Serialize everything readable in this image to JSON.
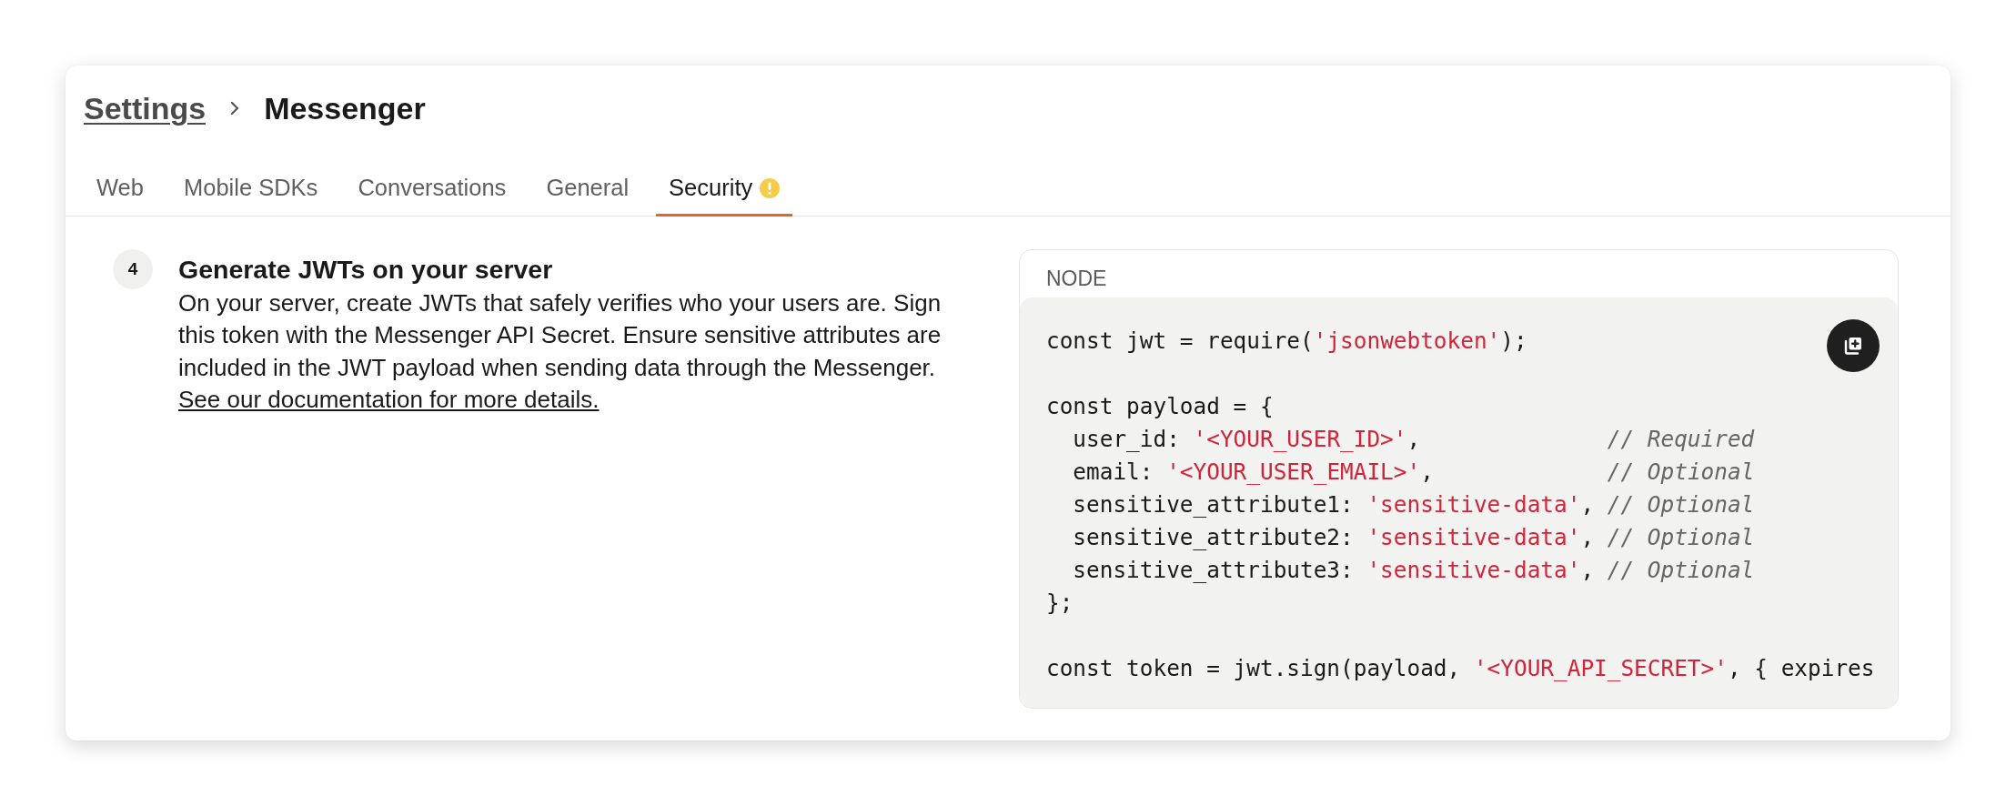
{
  "breadcrumb": {
    "parent": "Settings",
    "current": "Messenger"
  },
  "tabs": [
    {
      "label": "Web",
      "selected": false,
      "warning": false
    },
    {
      "label": "Mobile SDKs",
      "selected": false,
      "warning": false
    },
    {
      "label": "Conversations",
      "selected": false,
      "warning": false
    },
    {
      "label": "General",
      "selected": false,
      "warning": false
    },
    {
      "label": "Security",
      "selected": true,
      "warning": true
    }
  ],
  "step": {
    "number": "4",
    "title": "Generate JWTs on your server",
    "description": "On your server, create JWTs that safely verifies who your users are. Sign this token with the Messenger API Secret. Ensure sensitive attributes are included in the JWT payload when sending data through the Messenger.",
    "link": "See our documentation for more details."
  },
  "code_block": {
    "language": "NODE",
    "lines": [
      {
        "kind": "code",
        "tokens": [
          {
            "kind": "plain",
            "text": "const jwt = require("
          },
          {
            "kind": "string",
            "text": "'jsonwebtoken'"
          },
          {
            "kind": "plain",
            "text": ");"
          }
        ]
      },
      {
        "kind": "blank"
      },
      {
        "kind": "code",
        "tokens": [
          {
            "kind": "plain",
            "text": "const payload = {"
          }
        ]
      },
      {
        "kind": "code",
        "tokens": [
          {
            "kind": "plain",
            "text": "  user_id: "
          },
          {
            "kind": "string",
            "text": "'<YOUR_USER_ID>'"
          },
          {
            "kind": "plain",
            "text": ",              "
          },
          {
            "kind": "comment",
            "text": "// Required"
          }
        ]
      },
      {
        "kind": "code",
        "tokens": [
          {
            "kind": "plain",
            "text": "  email: "
          },
          {
            "kind": "string",
            "text": "'<YOUR_USER_EMAIL>'"
          },
          {
            "kind": "plain",
            "text": ",             "
          },
          {
            "kind": "comment",
            "text": "// Optional"
          }
        ]
      },
      {
        "kind": "code",
        "tokens": [
          {
            "kind": "plain",
            "text": "  sensitive_attribute1: "
          },
          {
            "kind": "string",
            "text": "'sensitive-data'"
          },
          {
            "kind": "plain",
            "text": ", "
          },
          {
            "kind": "comment",
            "text": "// Optional"
          }
        ]
      },
      {
        "kind": "code",
        "tokens": [
          {
            "kind": "plain",
            "text": "  sensitive_attribute2: "
          },
          {
            "kind": "string",
            "text": "'sensitive-data'"
          },
          {
            "kind": "plain",
            "text": ", "
          },
          {
            "kind": "comment",
            "text": "// Optional"
          }
        ]
      },
      {
        "kind": "code",
        "tokens": [
          {
            "kind": "plain",
            "text": "  sensitive_attribute3: "
          },
          {
            "kind": "string",
            "text": "'sensitive-data'"
          },
          {
            "kind": "plain",
            "text": ", "
          },
          {
            "kind": "comment",
            "text": "// Optional"
          }
        ]
      },
      {
        "kind": "code",
        "tokens": [
          {
            "kind": "plain",
            "text": "};"
          }
        ]
      },
      {
        "kind": "blank"
      },
      {
        "kind": "code",
        "tokens": [
          {
            "kind": "plain",
            "text": "const token = jwt.sign(payload, "
          },
          {
            "kind": "string",
            "text": "'<YOUR_API_SECRET>'"
          },
          {
            "kind": "plain",
            "text": ", { expires"
          }
        ]
      }
    ]
  }
}
